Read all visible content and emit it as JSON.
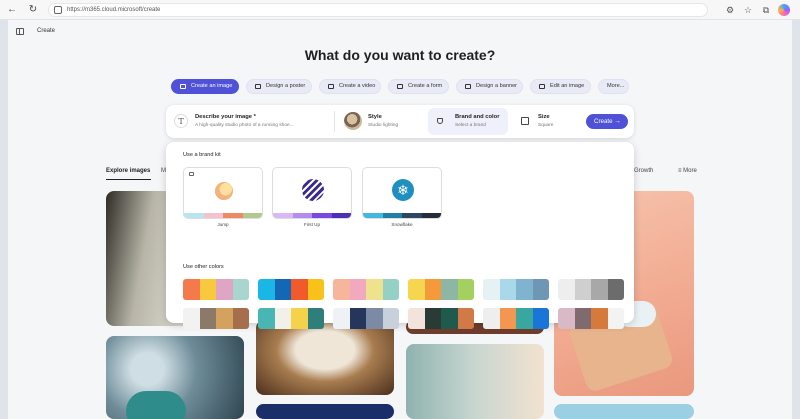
{
  "browser": {
    "url": "https://m365.cloud.microsoft/create",
    "back_icon": "arrow-left-icon",
    "refresh_icon": "refresh-icon"
  },
  "app": {
    "title": "Create",
    "headline": "What do you want to create?"
  },
  "actions": [
    {
      "label": "Create an image",
      "active": true
    },
    {
      "label": "Design a poster",
      "active": false
    },
    {
      "label": "Create a video",
      "active": false
    },
    {
      "label": "Create a form",
      "active": false
    },
    {
      "label": "Design a banner",
      "active": false
    },
    {
      "label": "Edit an image",
      "active": false
    },
    {
      "label": "More...",
      "active": false
    }
  ],
  "prompt": {
    "describe_title": "Describe your image *",
    "describe_placeholder": "A high-quality studio photo of a running shoe...",
    "style_title": "Style",
    "style_value": "Studio lighting",
    "brand_title": "Brand and color",
    "brand_value": "Select a brand",
    "size_title": "Size",
    "size_value": "Square",
    "create_label": "Create",
    "create_arrow": "→"
  },
  "gallery": {
    "tab_explore": "Explore images",
    "tab_partial": "M",
    "tab_growth": "Growth",
    "tab_more": "More",
    "more_icon": "filter-lines-icon"
  },
  "brand_panel": {
    "kit_label": "Use a brand kit",
    "other_label": "Use other colors",
    "kits": [
      {
        "name": "Jump",
        "strip": [
          "#b8e6f0",
          "#f4c2cf",
          "#ec8a63",
          "#b4c78e"
        ]
      },
      {
        "name": "First Up",
        "strip": [
          "#d9b8f6",
          "#b38cee",
          "#7a49e0",
          "#4d2fb8"
        ]
      },
      {
        "name": "Snowflake",
        "strip": [
          "#43b7dd",
          "#1f7fa8",
          "#2f4660",
          "#252c3a"
        ]
      }
    ],
    "palettes": [
      [
        "#f47a4b",
        "#f8c93f",
        "#e0a4c4",
        "#a8d6cf"
      ],
      [
        "#1ab7e6",
        "#1467b5",
        "#f15a2a",
        "#f9c21b"
      ],
      [
        "#f7b59c",
        "#f3a9bd",
        "#efe28e",
        "#94d1c4"
      ],
      [
        "#f6d54f",
        "#f59a3a",
        "#8db6a4",
        "#a4d05f"
      ],
      [
        "#e6f1f6",
        "#a9d8e8",
        "#7fb3cf",
        "#6e96b5"
      ],
      [
        "#eeeeee",
        "#cfcfcf",
        "#a8a8a8",
        "#6c6c6c"
      ],
      [
        "#f2f2f2",
        "#8b7a68",
        "#d2a25e",
        "#a66e4a"
      ],
      [
        "#4ab6b3",
        "#f1f1ea",
        "#f4d34a",
        "#2e7e7b"
      ],
      [
        "#eef1f5",
        "#26355b",
        "#7c8aa5",
        "#c8d0dc"
      ],
      [
        "#f2e4dc",
        "#2a3b36",
        "#1f5a4d",
        "#d27a47"
      ],
      [
        "#eeeeee",
        "#f3964f",
        "#39a7a0",
        "#1b75d8"
      ],
      [
        "#d9b9c5",
        "#7e6a6f",
        "#d67a3b",
        "#f3f3f3"
      ]
    ]
  }
}
